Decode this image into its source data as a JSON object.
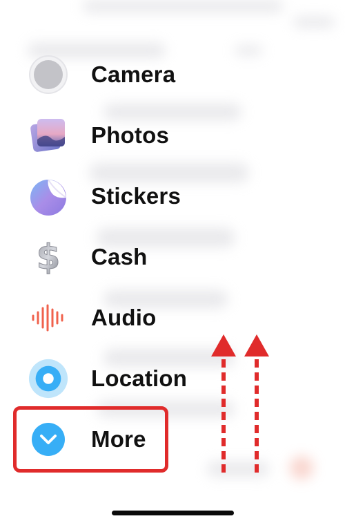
{
  "menu": {
    "items": [
      {
        "label": "Camera",
        "icon": "camera-icon"
      },
      {
        "label": "Photos",
        "icon": "photos-icon"
      },
      {
        "label": "Stickers",
        "icon": "stickers-icon"
      },
      {
        "label": "Cash",
        "icon": "cash-icon"
      },
      {
        "label": "Audio",
        "icon": "audio-icon"
      },
      {
        "label": "Location",
        "icon": "location-icon"
      },
      {
        "label": "More",
        "icon": "more-icon"
      }
    ]
  },
  "annotations": {
    "highlight_target": "More",
    "arrows": 2,
    "arrow_direction": "up",
    "annotation_color": "#e02b2b"
  },
  "colors": {
    "accent_blue": "#37aef6",
    "audio_red": "#f0624c"
  }
}
